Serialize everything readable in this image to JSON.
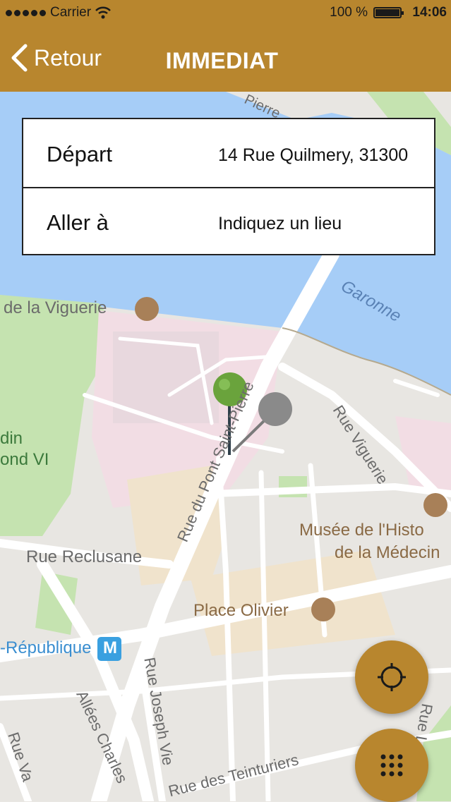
{
  "status_bar": {
    "carrier": "Carrier",
    "battery": "100 %",
    "time": "14:06"
  },
  "nav": {
    "back_label": "Retour",
    "title": "IMMEDIAT"
  },
  "form": {
    "departure": {
      "label": "Départ",
      "value": "14 Rue Quilmery, 31300"
    },
    "destination": {
      "label": "Aller à",
      "placeholder": "Indiquez un lieu"
    }
  },
  "map_labels": {
    "viguerie": "de la Viguerie",
    "jardin1": "din",
    "jardin2": "ond VI",
    "garonne": "Garonne",
    "rue_pont": "Rue du Pont Saint-Pierre",
    "rue_viguerie": "Rue Viguerie",
    "pierre": "Pierre",
    "musee1": "Musée de l'Histo",
    "musee2": "de la Médecin",
    "reclusane": "Rue Reclusane",
    "place_olivier": "Place Olivier",
    "republique": "-République",
    "metro": "M",
    "joseph_vie": "Rue Joseph Vie",
    "allees": "Allées Charles",
    "teinturiers": "Rue des Teinturiers",
    "rue_va": "Rue Va",
    "laganne": "Rue Laganne"
  },
  "icons": {
    "back": "chevron-left-icon",
    "locate": "crosshair-icon",
    "menu": "grid-icon"
  },
  "colors": {
    "brand": "#b8862e",
    "water": "#a6cdf7",
    "park": "#c5e3b0",
    "road": "#ffffff",
    "pin_green": "#6aa33c",
    "pin_gray": "#8a8a8a"
  }
}
